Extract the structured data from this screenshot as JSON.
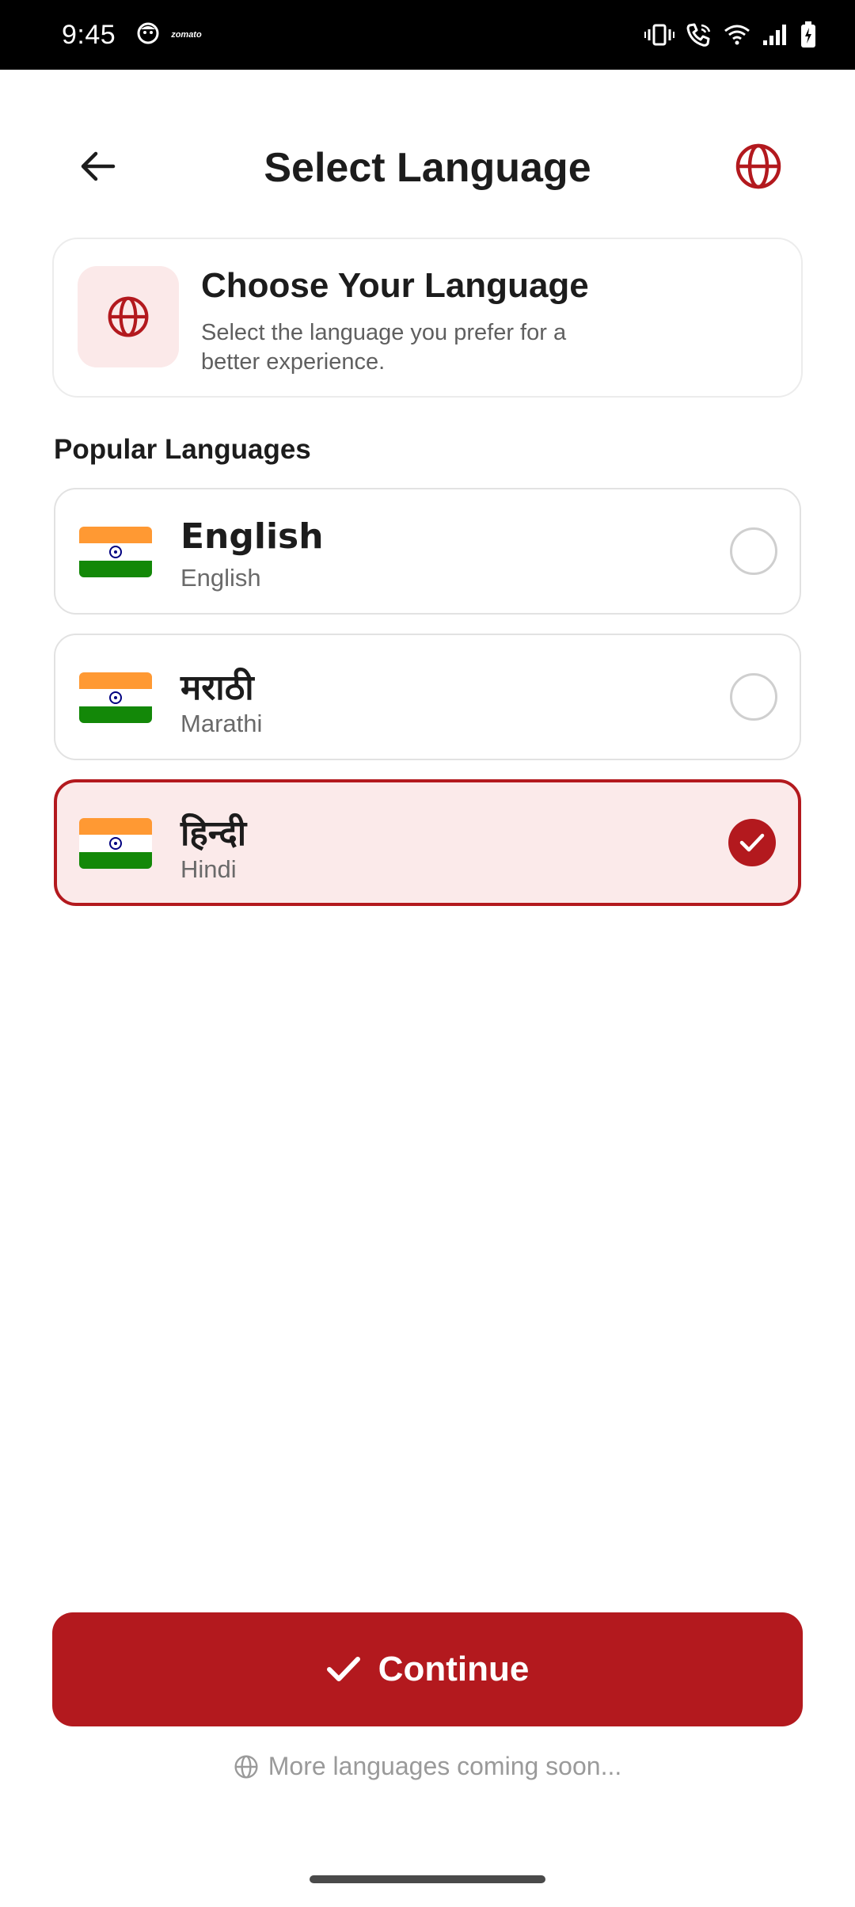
{
  "status_bar": {
    "time": "9:45",
    "left_icons": [
      "face-app-icon",
      "zomato-icon"
    ],
    "zomato_text": "zomato",
    "right_icons": [
      "vibrate-icon",
      "wifi-calling-icon",
      "wifi-icon",
      "signal-icon",
      "battery-charging-icon"
    ]
  },
  "header": {
    "title": "Select Language",
    "back_icon": "arrow-left-icon",
    "right_icon": "globe-icon"
  },
  "info_card": {
    "title": "Choose Your Language",
    "subtitle": "Select the language you prefer for a better experience.",
    "icon": "globe-icon"
  },
  "section": {
    "title": "Popular Languages"
  },
  "languages": [
    {
      "native": "English",
      "english": "English",
      "flag": "india-flag-icon",
      "selected": false
    },
    {
      "native": "मराठी",
      "english": "Marathi",
      "flag": "india-flag-icon",
      "selected": false
    },
    {
      "native": "हिन्दी",
      "english": "Hindi",
      "flag": "india-flag-icon",
      "selected": true
    }
  ],
  "actions": {
    "continue_label": "Continue",
    "continue_icon": "check-icon",
    "coming_soon": "More languages coming soon..."
  },
  "colors": {
    "accent": "#b3191e",
    "selected_bg": "#fbeaea",
    "icon_bg": "#fbe9e9"
  }
}
